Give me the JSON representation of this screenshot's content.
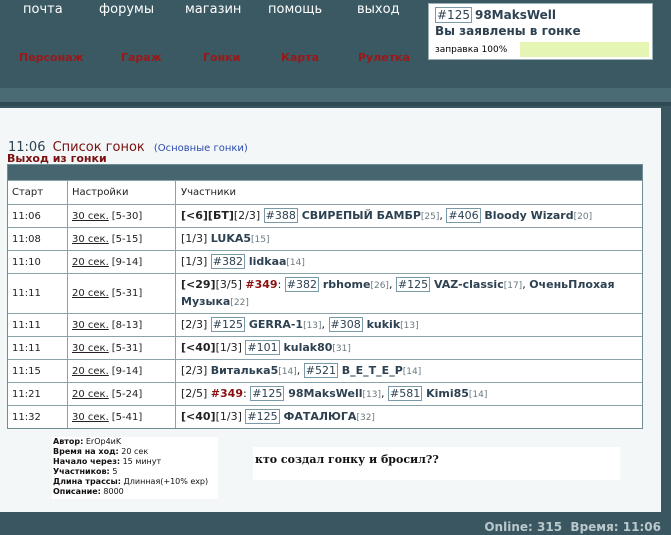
{
  "nav": {
    "top": [
      "почта",
      "форумы",
      "магазин",
      "помощь",
      "выход"
    ],
    "bottom": [
      "Персонаж",
      "Гараж",
      "Гонки",
      "Карта",
      "Рулетка"
    ]
  },
  "user": {
    "id_tag": "#125",
    "name": "98MaksWell",
    "status": "Вы заявлены в гонке",
    "fuel_label": "заправка 100%",
    "fuel_fraction": 1.0
  },
  "page": {
    "time": "11:06",
    "title": "Список гонок",
    "subtitle": "(Основные гонки)",
    "exit_link": "Выход из гонки"
  },
  "table": {
    "headers": [
      "Старт",
      "Настройки",
      "Участники"
    ],
    "rows": [
      {
        "start": "11:06",
        "time": "30 сек.",
        "range": "[5-30]",
        "height": 23,
        "items": [
          {
            "t": "lim",
            "v": "[<6][БТ]"
          },
          {
            "t": "slot",
            "v": "[2/3] "
          },
          {
            "t": "tag",
            "v": "#388"
          },
          {
            "t": "name",
            "v": " СВИРЕПЫЙ БАМБР"
          },
          {
            "t": "lvl",
            "v": "[25]"
          },
          {
            "t": "sep",
            "v": ", "
          },
          {
            "t": "tag",
            "v": "#406"
          },
          {
            "t": "name",
            "v": " Bloody Wizard"
          },
          {
            "t": "lvl",
            "v": "[20]"
          }
        ]
      },
      {
        "start": "11:08",
        "time": "30 сек.",
        "range": "[5-15]",
        "height": 23,
        "items": [
          {
            "t": "slot",
            "v": "[1/3] "
          },
          {
            "t": "name",
            "v": "LUKA5"
          },
          {
            "t": "lvl",
            "v": "[15]"
          }
        ]
      },
      {
        "start": "11:10",
        "time": "20 сек.",
        "range": "[9-14]",
        "height": 23,
        "items": [
          {
            "t": "slot",
            "v": "[1/3] "
          },
          {
            "t": "tag",
            "v": "#382"
          },
          {
            "t": "name",
            "v": " lidkaa"
          },
          {
            "t": "lvl",
            "v": "[14]"
          }
        ]
      },
      {
        "start": "11:11",
        "time": "20 сек.",
        "range": "[5-31]",
        "height": 40,
        "items": [
          {
            "t": "lim",
            "v": "[<29]"
          },
          {
            "t": "slot",
            "v": "[3/5] "
          },
          {
            "t": "hl",
            "v": "#349"
          },
          {
            "t": "sep",
            "v": ": "
          },
          {
            "t": "tag",
            "v": "#382"
          },
          {
            "t": "name",
            "v": " rbhome"
          },
          {
            "t": "lvl",
            "v": "[26]"
          },
          {
            "t": "sep",
            "v": ", "
          },
          {
            "t": "tag",
            "v": "#125"
          },
          {
            "t": "name",
            "v": " VAZ-classic"
          },
          {
            "t": "lvl",
            "v": "[17]"
          },
          {
            "t": "sep",
            "v": ", "
          },
          {
            "t": "name",
            "v": "ОченьПлохая Музыка"
          },
          {
            "t": "lvl",
            "v": "[22]"
          }
        ]
      },
      {
        "start": "11:11",
        "time": "30 сек.",
        "range": "[8-13]",
        "height": 23,
        "items": [
          {
            "t": "slot",
            "v": "[2/3] "
          },
          {
            "t": "tag",
            "v": "#125"
          },
          {
            "t": "name",
            "v": " GERRA-1"
          },
          {
            "t": "lvl",
            "v": "[13]"
          },
          {
            "t": "sep",
            "v": ", "
          },
          {
            "t": "tag",
            "v": "#308"
          },
          {
            "t": "name",
            "v": " kukik"
          },
          {
            "t": "lvl",
            "v": "[13]"
          }
        ]
      },
      {
        "start": "11:11",
        "time": "30 сек.",
        "range": "[5-31]",
        "height": 23,
        "items": [
          {
            "t": "lim",
            "v": "[<40]"
          },
          {
            "t": "slot",
            "v": "[1/3] "
          },
          {
            "t": "tag",
            "v": "#101"
          },
          {
            "t": "name",
            "v": " kulak80"
          },
          {
            "t": "lvl",
            "v": "[31]"
          }
        ]
      },
      {
        "start": "11:15",
        "time": "20 сек.",
        "range": "[9-14]",
        "height": 23,
        "items": [
          {
            "t": "slot",
            "v": "[2/3] "
          },
          {
            "t": "name",
            "v": "Виталька5"
          },
          {
            "t": "lvl",
            "v": "[14]"
          },
          {
            "t": "sep",
            "v": ", "
          },
          {
            "t": "tag",
            "v": "#521"
          },
          {
            "t": "name",
            "v": " В_Е_Т_Е_Р"
          },
          {
            "t": "lvl",
            "v": "[14]"
          }
        ]
      },
      {
        "start": "11:21",
        "time": "20 сек.",
        "range": "[5-24]",
        "height": 23,
        "items": [
          {
            "t": "slot",
            "v": "[2/5] "
          },
          {
            "t": "hl",
            "v": "#349"
          },
          {
            "t": "sep",
            "v": ": "
          },
          {
            "t": "tag",
            "v": "#125"
          },
          {
            "t": "name",
            "v": " 98MaksWell"
          },
          {
            "t": "lvl",
            "v": "[13]"
          },
          {
            "t": "sep",
            "v": ", "
          },
          {
            "t": "tag",
            "v": "#581"
          },
          {
            "t": "name",
            "v": " Kimi85"
          },
          {
            "t": "lvl",
            "v": "[14]"
          }
        ]
      },
      {
        "start": "11:32",
        "time": "30 сек.",
        "range": "[5-41]",
        "height": 23,
        "items": [
          {
            "t": "lim",
            "v": "[<40]"
          },
          {
            "t": "slot",
            "v": "[1/3] "
          },
          {
            "t": "tag",
            "v": "#125"
          },
          {
            "t": "name",
            "v": " ФАТАЛЮГА"
          },
          {
            "t": "lvl",
            "v": "[32]"
          }
        ]
      }
    ]
  },
  "tooltip": {
    "author_label": "Автор:",
    "author": "ErOp4иK",
    "move_label": "Время на ход:",
    "move": "20 сек",
    "start_label": "Начало через:",
    "start": "15 минут",
    "players_label": "Участников:",
    "players": "5",
    "track_label": "Длина трассы:",
    "track": "Длинная(+10% exp)",
    "desc_label": "Описание:",
    "desc": "8000"
  },
  "comment": "кто создал гонку и бросил??",
  "footer": {
    "online_label": "Online:",
    "online": "315",
    "time_label": "Время:",
    "time": "11:06"
  }
}
